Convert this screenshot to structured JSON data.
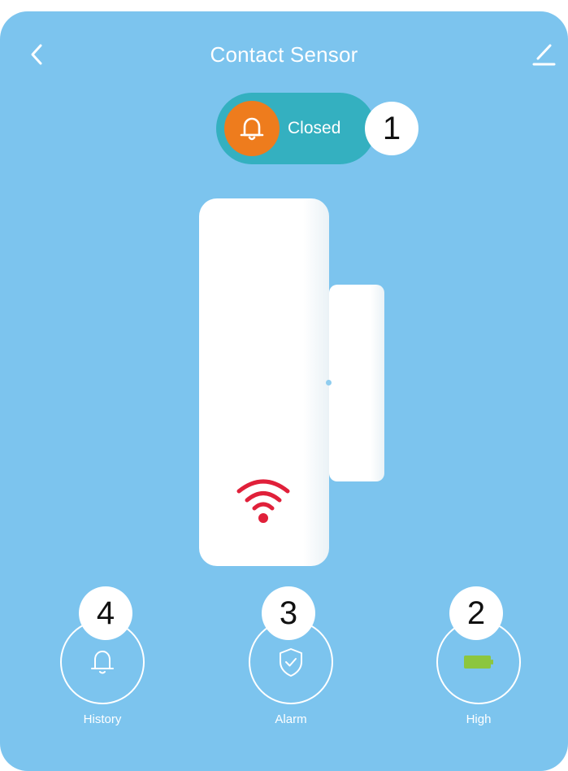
{
  "header": {
    "title": "Contact Sensor",
    "back_icon": "chevron-left-icon",
    "edit_icon": "edit-pencil-icon"
  },
  "status": {
    "label": "Closed",
    "icon": "bell-icon",
    "icon_color": "#ee7c1d",
    "pill_color": "#34b0c0"
  },
  "callouts": {
    "c1": "1",
    "c2": "2",
    "c3": "3",
    "c4": "4"
  },
  "controls": {
    "history": {
      "label": "History",
      "icon": "bell-icon"
    },
    "alarm": {
      "label": "Alarm",
      "icon": "shield-check-icon"
    },
    "battery": {
      "label": "High",
      "icon": "battery-icon",
      "battery_color": "#8cc63f"
    }
  },
  "device": {
    "signal_icon": "wifi-icon",
    "signal_color": "#e0203a"
  },
  "colors": {
    "background": "#7cc4ee",
    "text": "#ffffff"
  }
}
